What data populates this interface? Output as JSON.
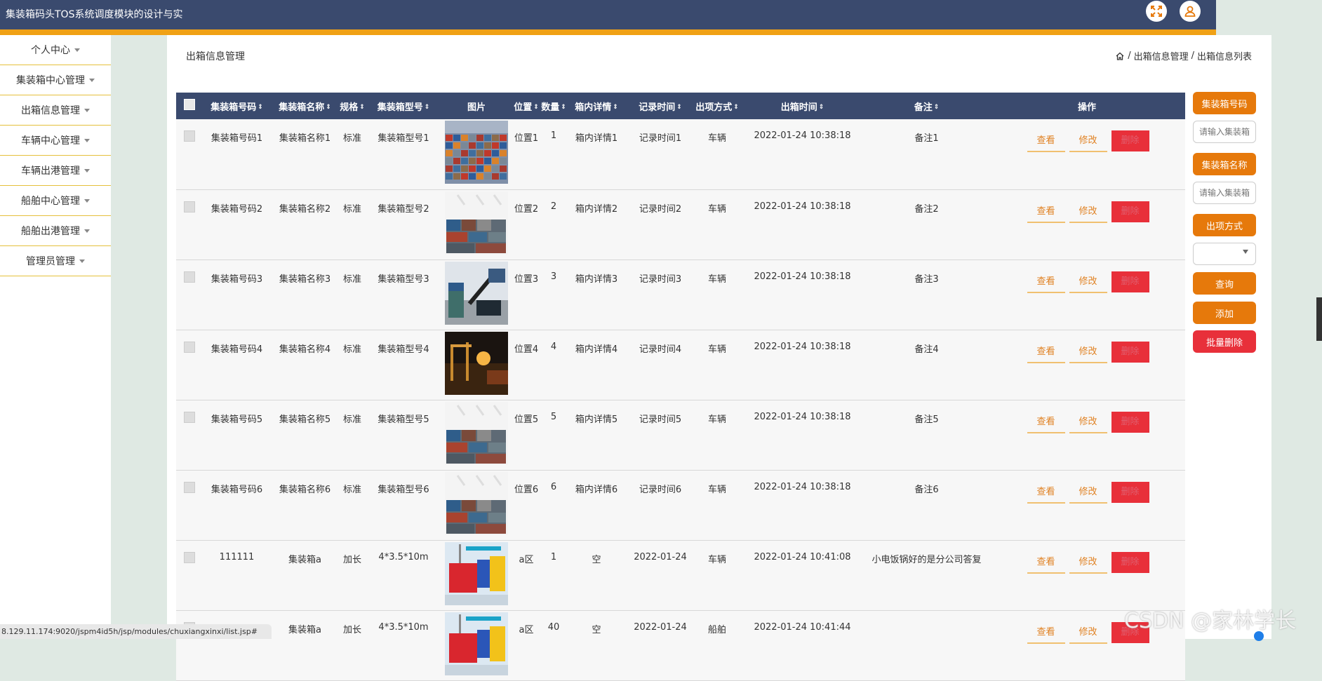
{
  "app": {
    "title": "集装箱码头TOS系统调度模块的设计与实"
  },
  "sidebar": {
    "items": [
      {
        "label": "个人中心"
      },
      {
        "label": "集装箱中心管理"
      },
      {
        "label": "出箱信息管理"
      },
      {
        "label": "车辆中心管理"
      },
      {
        "label": "车辆出港管理"
      },
      {
        "label": "船舶中心管理"
      },
      {
        "label": "船舶出港管理"
      },
      {
        "label": "管理员管理"
      }
    ]
  },
  "page": {
    "title": "出箱信息管理",
    "breadcrumb": [
      "出箱信息管理",
      "出箱信息列表"
    ],
    "separator": "/"
  },
  "table": {
    "sort_glyph": "⇕",
    "headers": [
      "集装箱号码",
      "集装箱名称",
      "规格",
      "集装箱型号",
      "图片",
      "位置",
      "数量",
      "箱内详情",
      "记录时间",
      "出项方式",
      "出箱时间",
      "备注",
      "操作"
    ],
    "view_label": "查看",
    "edit_label": "修改",
    "delete_label": "删除",
    "rows": [
      {
        "code": "集装箱号码1",
        "name": "集装箱名称1",
        "spec": "标准",
        "model": "集装箱型号1",
        "image": "port-yard",
        "position": "位置1",
        "quantity": "1",
        "details": "箱内详情1",
        "record_time": "记录时间1",
        "method": "车辆",
        "out_time": "2022-01-24 10:38:18",
        "remark": "备注1"
      },
      {
        "code": "集装箱号码2",
        "name": "集装箱名称2",
        "spec": "标准",
        "model": "集装箱型号2",
        "image": "container-stack",
        "position": "位置2",
        "quantity": "2",
        "details": "箱内详情2",
        "record_time": "记录时间2",
        "method": "车辆",
        "out_time": "2022-01-24 10:38:18",
        "remark": "备注2"
      },
      {
        "code": "集装箱号码3",
        "name": "集装箱名称3",
        "spec": "标准",
        "model": "集装箱型号3",
        "image": "reach-stacker",
        "position": "位置3",
        "quantity": "3",
        "details": "箱内详情3",
        "record_time": "记录时间3",
        "method": "车辆",
        "out_time": "2022-01-24 10:38:18",
        "remark": "备注3"
      },
      {
        "code": "集装箱号码4",
        "name": "集装箱名称4",
        "spec": "标准",
        "model": "集装箱型号4",
        "image": "night-port",
        "position": "位置4",
        "quantity": "4",
        "details": "箱内详情4",
        "record_time": "记录时间4",
        "method": "车辆",
        "out_time": "2022-01-24 10:38:18",
        "remark": "备注4"
      },
      {
        "code": "集装箱号码5",
        "name": "集装箱名称5",
        "spec": "标准",
        "model": "集装箱型号5",
        "image": "container-stack",
        "position": "位置5",
        "quantity": "5",
        "details": "箱内详情5",
        "record_time": "记录时间5",
        "method": "车辆",
        "out_time": "2022-01-24 10:38:18",
        "remark": "备注5"
      },
      {
        "code": "集装箱号码6",
        "name": "集装箱名称6",
        "spec": "标准",
        "model": "集装箱型号6",
        "image": "container-stack",
        "position": "位置6",
        "quantity": "6",
        "details": "箱内详情6",
        "record_time": "记录时间6",
        "method": "车辆",
        "out_time": "2022-01-24 10:38:18",
        "remark": "备注6"
      },
      {
        "code": "111111",
        "name": "集装箱a",
        "spec": "加长",
        "model": "4*3.5*10m",
        "image": "colored-containers",
        "position": "a区",
        "quantity": "1",
        "details": "空",
        "record_time": "2022-01-24",
        "method": "车辆",
        "out_time": "2022-01-24 10:41:08",
        "remark": "小电饭锅好的是分公司答复"
      },
      {
        "code": "",
        "name": "集装箱a",
        "spec": "加长",
        "model": "4*3.5*10m",
        "image": "colored-containers",
        "position": "a区",
        "quantity": "40",
        "details": "空",
        "record_time": "2022-01-24",
        "method": "船舶",
        "out_time": "2022-01-24 10:41:44",
        "remark": ""
      }
    ]
  },
  "search": {
    "code_label": "集装箱号码",
    "code_placeholder": "请输入集装箱号码",
    "name_label": "集装箱名称",
    "name_placeholder": "请输入集装箱名称",
    "method_label": "出项方式",
    "method_value": "",
    "query_label": "查询",
    "add_label": "添加",
    "batch_delete_label": "批量删除"
  },
  "status_url": "8.129.11.174:9020/jspm4id5h/jsp/modules/chuxiangxinxi/list.jsp#",
  "watermark": "CSDN @家林学长",
  "colors": {
    "header_bg": "#3a4a6e",
    "accent_orange": "#e6790b",
    "strip_yellow": "#f0a115",
    "delete_red": "#e8303a"
  }
}
